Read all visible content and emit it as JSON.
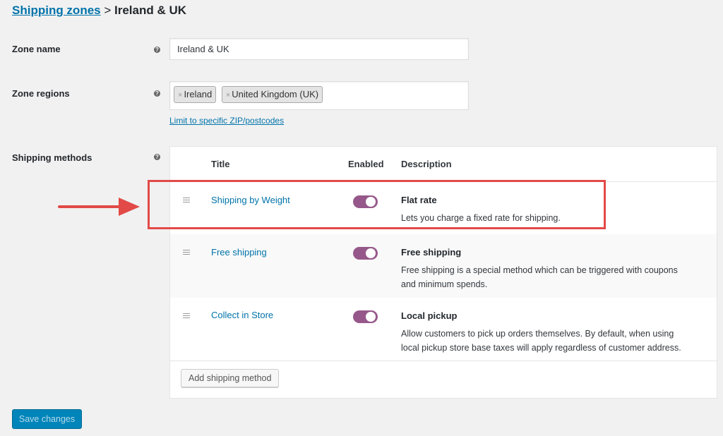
{
  "breadcrumb": {
    "link": "Shipping zones",
    "separator": " > ",
    "current": "Ireland & UK"
  },
  "zone_name": {
    "label": "Zone name",
    "value": "Ireland & UK"
  },
  "zone_regions": {
    "label": "Zone regions",
    "chips": [
      {
        "remove": "×",
        "label": "Ireland"
      },
      {
        "remove": "×",
        "label": "United Kingdom (UK)"
      }
    ],
    "limit_link": "Limit to specific ZIP/postcodes"
  },
  "shipping_methods": {
    "label": "Shipping methods",
    "columns": {
      "title": "Title",
      "enabled": "Enabled",
      "description": "Description"
    },
    "rows": [
      {
        "title": "Shipping by Weight",
        "enabled": true,
        "method": "Flat rate",
        "lines": [
          "Lets you charge a fixed rate for shipping."
        ]
      },
      {
        "title": "Free shipping",
        "enabled": true,
        "method": "Free shipping",
        "lines": [
          "Free shipping is a special method which can be triggered with coupons",
          "and minimum spends."
        ]
      },
      {
        "title": "Collect in Store",
        "enabled": true,
        "method": "Local pickup",
        "lines": [
          "Allow customers to pick up orders themselves. By default, when using",
          "local pickup store base taxes will apply regardless of customer address."
        ]
      }
    ],
    "add_button": "Add shipping method"
  },
  "save_button": "Save changes",
  "colors": {
    "link": "#0073aa",
    "toggle_on": "#96588a",
    "highlight": "#e24a47",
    "primary": "#0085ba"
  },
  "icons": {
    "help": "question-circle-icon",
    "drag": "drag-handle-icon",
    "arrow": "arrow-right-icon"
  }
}
